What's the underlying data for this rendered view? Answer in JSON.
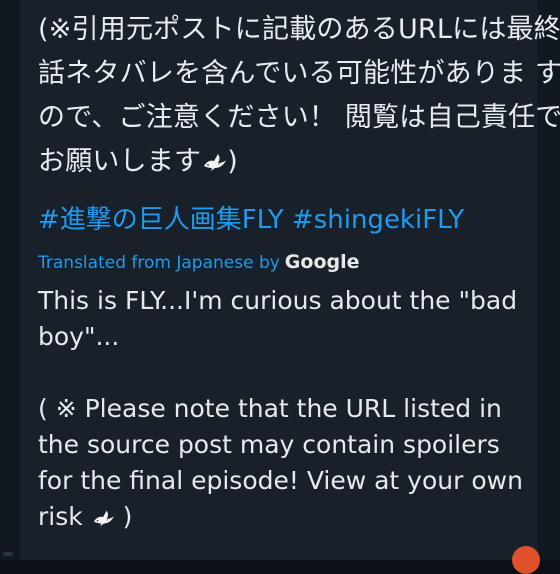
{
  "original_text": {
    "lines": [
      "(※引用元ポストに記載のあるURLには最終",
      "話ネタバレを含んでいる可能性がありま す",
      "ので、ご注意ください！ 閲覧は自己責任で",
      "お願いします"
    ],
    "closing": ")"
  },
  "hashtags": [
    "#進撃の巨人画集FLY",
    "#shingekiFLY"
  ],
  "translation": {
    "label": "Translated from Japanese by",
    "provider": "Google"
  },
  "translated_text": {
    "paragraph1": "This is FLY...I'm curious about the \"bad boy\"...",
    "paragraph2_prefix": "( ※ Please note that the URL listed in the source post may contain spoilers for the final episode! View at your own risk",
    "paragraph2_suffix": ")"
  },
  "icons": {
    "dove": "dove-emoji-icon"
  },
  "colors": {
    "background": "#18212a",
    "text": "#e7e9ea",
    "link": "#1d9bf0",
    "badge": "#e0502a"
  }
}
